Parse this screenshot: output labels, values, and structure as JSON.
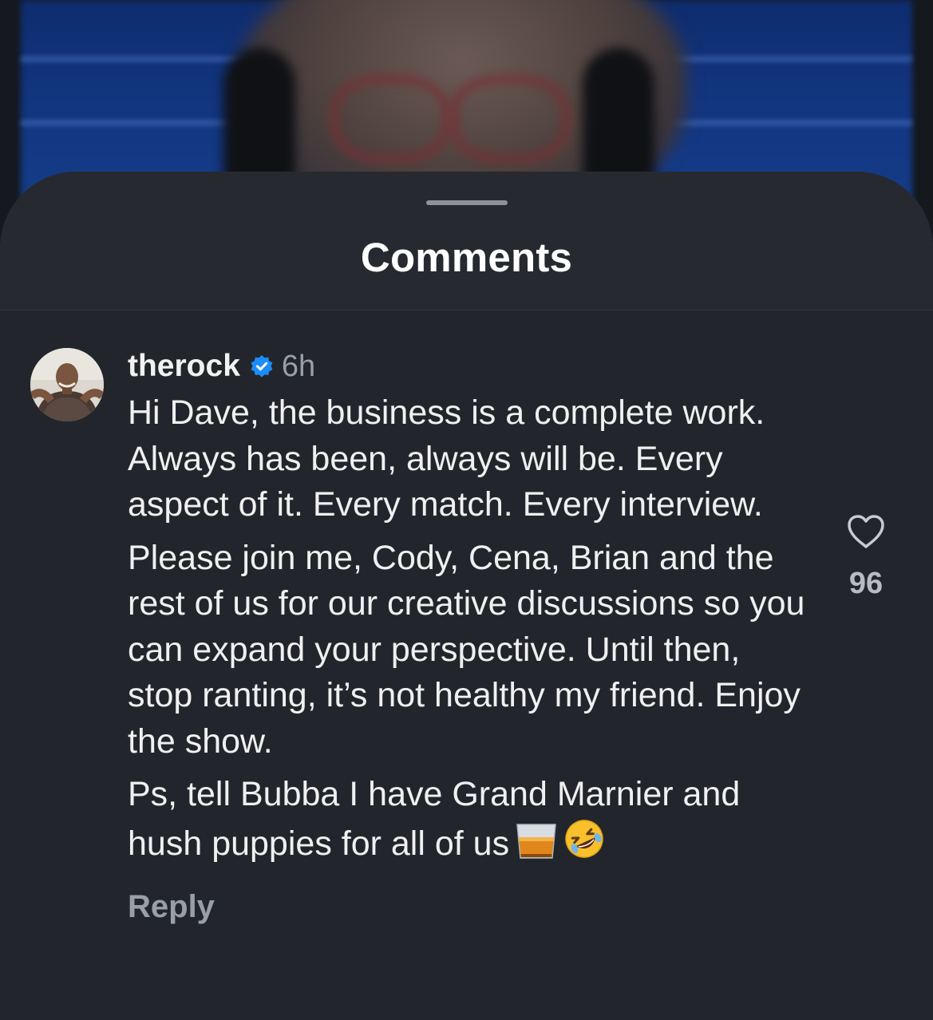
{
  "sheet": {
    "title": "Comments"
  },
  "comment": {
    "username": "therock",
    "verified_icon": "verified-badge-icon",
    "timestamp": "6h",
    "paragraphs": [
      "Hi Dave, the business is a complete work. Always has been, always will be. Every aspect of it. Every match. Every interview.",
      "Please join me, Cody, Cena, Brian and the rest of us for our creative discussions so you can expand your perspective. Until then, stop ranting, it’s not healthy my friend. Enjoy the show.",
      "Ps, tell Bubba I have Grand Marnier and hush puppies for all of us"
    ],
    "emojis": [
      "tumbler-glass-icon",
      "rolling-on-floor-laughing-icon"
    ],
    "reply_label": "Reply",
    "like_count": "96"
  },
  "colors": {
    "sheet_background": "#262a30",
    "text_primary": "#f0f0f0",
    "text_secondary": "#9a9ea5",
    "verified_blue": "#1d8cf8"
  }
}
